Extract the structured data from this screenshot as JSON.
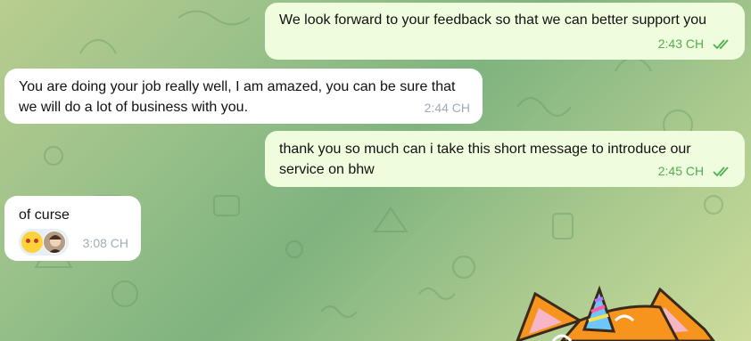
{
  "messages": [
    {
      "direction": "outgoing",
      "text": "We look forward to your feedback so that we can better support you",
      "time": "2:43 CH",
      "status": "read"
    },
    {
      "direction": "incoming",
      "text": "You are doing your job really well, I am amazed, you can be sure that we will do a lot of business with you.",
      "time": "2:44 CH"
    },
    {
      "direction": "outgoing",
      "text": "thank you so much can i take this short message to introduce our service on bhw",
      "time": "2:45 CH",
      "status": "read"
    },
    {
      "direction": "incoming",
      "text": "of curse",
      "time": "3:08 CH",
      "reactions": [
        "smiling-face-with-hearts-emoji",
        "user-avatar"
      ]
    }
  ],
  "colors": {
    "outgoing_bubble": "#effdde",
    "incoming_bubble": "#ffffff",
    "outgoing_meta": "#4fae4e",
    "incoming_meta": "#a0acb6"
  },
  "sticker": "unicorn-cat-sticker"
}
